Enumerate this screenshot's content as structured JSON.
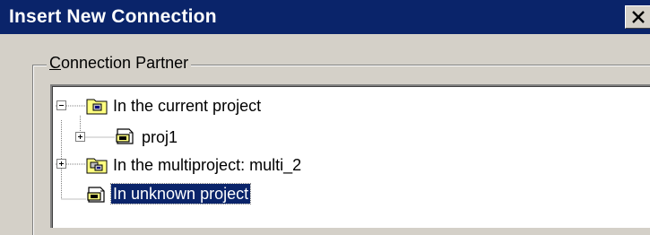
{
  "window": {
    "title": "Insert New Connection",
    "close_icon": "close-icon"
  },
  "group": {
    "label_first": "C",
    "label_rest": "onnection Partner"
  },
  "tree": {
    "nodes": [
      {
        "label": "In the current project",
        "icon": "folder-project-icon",
        "expander": "collapse",
        "level": 0
      },
      {
        "label": "proj1",
        "icon": "station-icon",
        "expander": "expand",
        "level": 1
      },
      {
        "label": "In the multiproject: multi_2",
        "icon": "multiproject-icon",
        "expander": "expand",
        "level": 0
      },
      {
        "label": "In unknown project",
        "icon": "station-icon",
        "expander": "none",
        "level": 0,
        "selected": true
      }
    ]
  },
  "colors": {
    "titlebar": "#0a246a",
    "selection": "#0a246a",
    "dialog_bg": "#d4d0c8",
    "folder_yellow": "#ffff80"
  }
}
